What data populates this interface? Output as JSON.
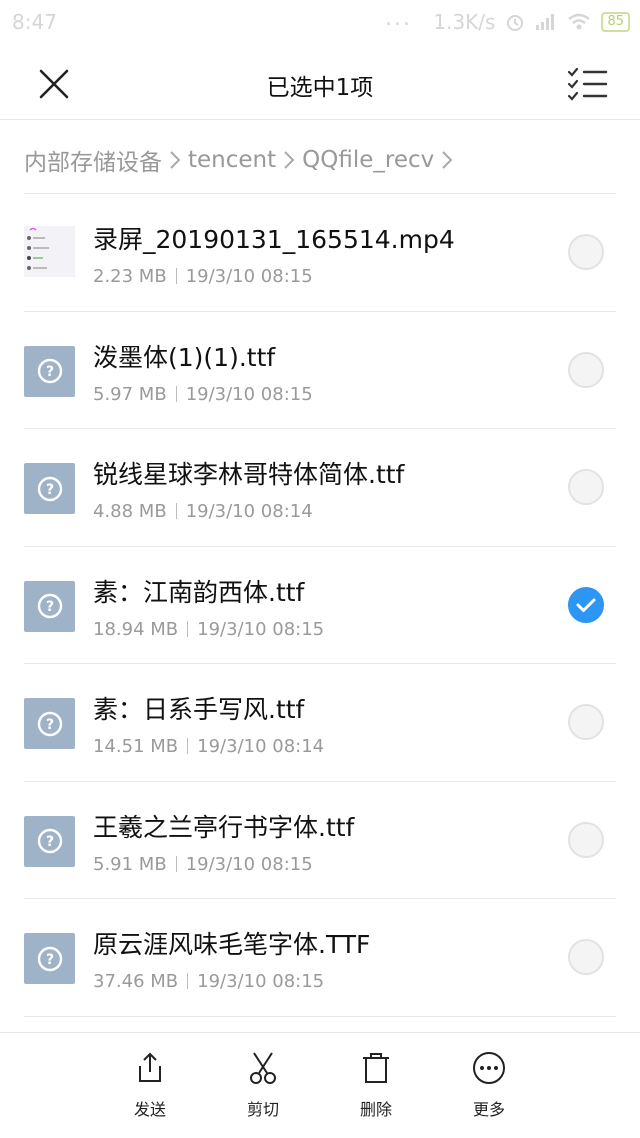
{
  "status_bar": {
    "time": "8:47",
    "dots": "...",
    "speed": "1.3K/s",
    "battery": "85"
  },
  "header": {
    "title": "已选中1项",
    "close_icon": "close-icon",
    "select_all_icon": "checklist-icon"
  },
  "breadcrumb": [
    "内部存储设备",
    "tencent",
    "QQfile_recv"
  ],
  "files": [
    {
      "name": "录屏_20190131_165514.mp4",
      "size": "2.23 MB",
      "date": "19/3/10 08:15",
      "type": "video",
      "selected": false
    },
    {
      "name": "泼墨体(1)(1).ttf",
      "size": "5.97 MB",
      "date": "19/3/10 08:15",
      "type": "unknown",
      "selected": false
    },
    {
      "name": "锐线星球李林哥特体简体.ttf",
      "size": "4.88 MB",
      "date": "19/3/10 08:14",
      "type": "unknown",
      "selected": false
    },
    {
      "name": "素：江南韵西体.ttf",
      "size": "18.94 MB",
      "date": "19/3/10 08:15",
      "type": "unknown",
      "selected": true
    },
    {
      "name": "素：日系手写风.ttf",
      "size": "14.51 MB",
      "date": "19/3/10 08:14",
      "type": "unknown",
      "selected": false
    },
    {
      "name": "王羲之兰亭行书字体.ttf",
      "size": "5.91 MB",
      "date": "19/3/10 08:15",
      "type": "unknown",
      "selected": false
    },
    {
      "name": "原云涯风味毛笔字体.TTF",
      "size": "37.46 MB",
      "date": "19/3/10 08:15",
      "type": "unknown",
      "selected": false
    }
  ],
  "toolbar": {
    "send": "发送",
    "cut": "剪切",
    "delete": "删除",
    "more": "更多"
  },
  "colors": {
    "accent": "#2d95f2",
    "file_icon_bg": "#9fb3c8",
    "secondary_text": "#9a9a9a"
  }
}
